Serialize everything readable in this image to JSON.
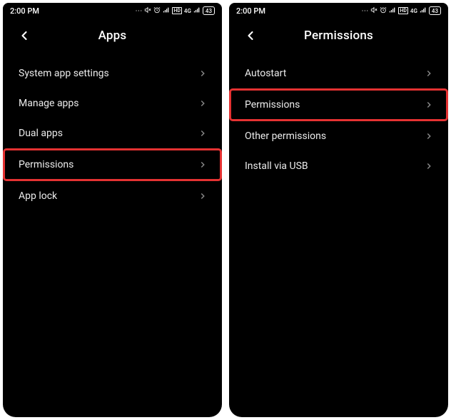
{
  "status": {
    "time": "2:00 PM",
    "battery": "43"
  },
  "screen1": {
    "title": "Apps",
    "items": [
      {
        "label": "System app settings",
        "highlight": false
      },
      {
        "label": "Manage apps",
        "highlight": false
      },
      {
        "label": "Dual apps",
        "highlight": false
      },
      {
        "label": "Permissions",
        "highlight": true
      },
      {
        "label": "App lock",
        "highlight": false
      }
    ]
  },
  "screen2": {
    "title": "Permissions",
    "items": [
      {
        "label": "Autostart",
        "highlight": false
      },
      {
        "label": "Permissions",
        "highlight": true
      },
      {
        "label": "Other permissions",
        "highlight": false
      },
      {
        "label": "Install via USB",
        "highlight": false
      }
    ]
  }
}
